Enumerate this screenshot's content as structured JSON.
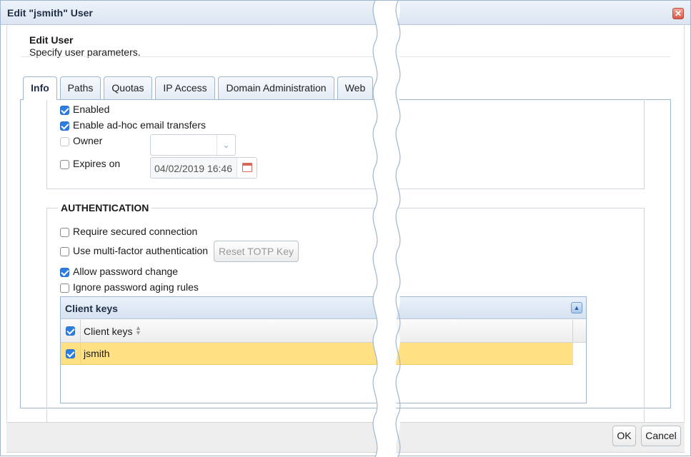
{
  "window": {
    "title": "Edit \"jsmith\" User",
    "close_icon": "close-icon"
  },
  "header": {
    "title": "Edit User",
    "subtitle": "Specify user parameters."
  },
  "tabs": [
    {
      "label": "Info",
      "active": true
    },
    {
      "label": "Paths",
      "active": false
    },
    {
      "label": "Quotas",
      "active": false
    },
    {
      "label": "IP Access",
      "active": false
    },
    {
      "label": "Domain Administration",
      "active": false
    },
    {
      "label": "Web",
      "active": false
    }
  ],
  "info": {
    "enabled": {
      "label": "Enabled",
      "checked": true
    },
    "adhoc": {
      "label": "Enable ad-hoc email transfers",
      "checked": true
    },
    "owner": {
      "label": "Owner",
      "checked": false,
      "disabled": true,
      "value": ""
    },
    "expires": {
      "label": "Expires on",
      "checked": false,
      "value": "04/02/2019 16:46"
    }
  },
  "authentication": {
    "legend": "AUTHENTICATION",
    "require_secured": {
      "label": "Require secured connection",
      "checked": false
    },
    "mfa": {
      "label": "Use multi-factor authentication",
      "checked": false
    },
    "reset_totp": "Reset TOTP Key",
    "allow_password_change": {
      "label": "Allow password change",
      "checked": true
    },
    "ignore_aging": {
      "label": "Ignore password aging rules",
      "checked": false
    }
  },
  "client_keys": {
    "title": "Client keys",
    "column": "Client keys",
    "rows": [
      {
        "name": "jsmith",
        "checked": true,
        "selected": true
      }
    ]
  },
  "footer": {
    "ok": "OK",
    "cancel": "Cancel"
  },
  "colors": {
    "accent": "#2e7de1",
    "border": "#9fb6cf",
    "selected_row": "#ffe082"
  }
}
